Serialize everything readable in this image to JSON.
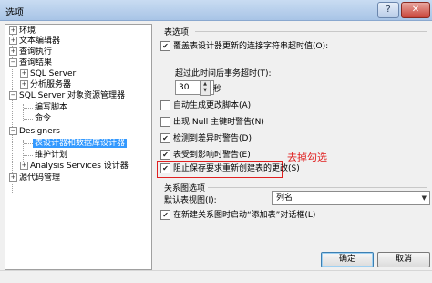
{
  "window": {
    "title": "选项",
    "help": "?",
    "close": "✕"
  },
  "tree": [
    {
      "label": "环境",
      "expander": "+"
    },
    {
      "label": "文本编辑器",
      "expander": "+"
    },
    {
      "label": "查询执行",
      "expander": "+"
    },
    {
      "label": "查询结果",
      "expander": "−"
    },
    {
      "label": "SQL Server",
      "expander": "+"
    },
    {
      "label": "分析服务器",
      "expander": "+"
    },
    {
      "label": "SQL Server 对象资源管理器",
      "expander": "−"
    },
    {
      "label": "编写脚本",
      "expander": ""
    },
    {
      "label": "命令",
      "expander": ""
    },
    {
      "label": "Designers",
      "expander": "−"
    },
    {
      "label": "表设计器和数据库设计器",
      "expander": "",
      "selected": true
    },
    {
      "label": "维护计划",
      "expander": ""
    },
    {
      "label": "Analysis Services 设计器",
      "expander": "+"
    },
    {
      "label": "源代码管理",
      "expander": "+"
    }
  ],
  "table_options": {
    "group_title": "表选项",
    "timeout_checkbox": {
      "label": "覆盖表设计器更新的连接字符串超时值(O):",
      "checked": true
    },
    "timeout_label": "超过此时间后事务超时(T):",
    "timeout_value": "30",
    "timeout_unit": "秒",
    "options": [
      {
        "label": "自动生成更改脚本(A)",
        "checked": false
      },
      {
        "label": "出现 Null 主键时警告(N)",
        "checked": false
      },
      {
        "label": "检测到差异时警告(D)",
        "checked": true
      },
      {
        "label": "表受到影响时警告(E)",
        "checked": true
      },
      {
        "label": "阻止保存要求重新创建表的更改(S)",
        "checked": true
      }
    ]
  },
  "annotation": "去掉勾选",
  "relationship": {
    "group_title": "关系图选项",
    "default_view_label": "默认表视图(I):",
    "default_view_value": "列名",
    "add_table_checkbox": {
      "label": "在新建关系图时启动“添加表”对话框(L)",
      "checked": true
    }
  },
  "buttons": {
    "ok": "确定",
    "cancel": "取消"
  },
  "colors": {
    "selection": "#3399ff",
    "annotation": "#e02020"
  }
}
